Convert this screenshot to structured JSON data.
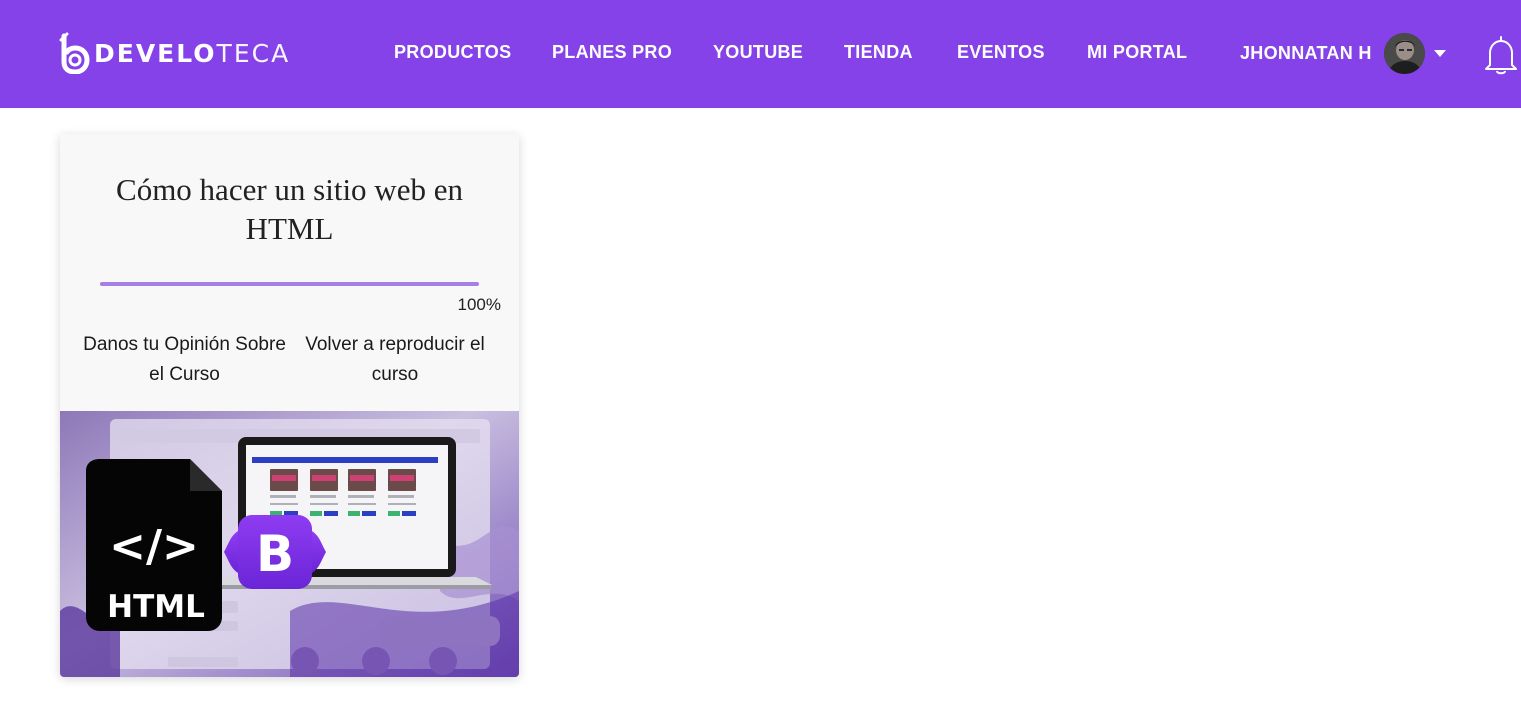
{
  "colors": {
    "header_bg": "#8442e8",
    "progress_fill": "#a67ee6",
    "bootstrap_purple": "#7a2fe6"
  },
  "brand": {
    "logo_icon": "develoteca-b-icon",
    "name_bold": "DEVELO",
    "name_light": "TECA"
  },
  "nav": {
    "items": [
      {
        "label": "PRODUCTOS"
      },
      {
        "label": "PLANES PRO"
      },
      {
        "label": "YOUTUBE"
      },
      {
        "label": "TIENDA"
      },
      {
        "label": "EVENTOS"
      },
      {
        "label": "MI PORTAL"
      }
    ]
  },
  "user": {
    "name": "JHONNATAN H",
    "avatar_icon": "user-avatar",
    "menu_icon": "caret-down-icon"
  },
  "notifications": {
    "icon": "bell-icon"
  },
  "course": {
    "title": "Cómo hacer un sitio web en HTML",
    "progress": 1.0,
    "progress_label": "100%",
    "actions": {
      "opinion": "Danos tu Opinión Sobre el Curso",
      "replay": "Volver a reproducir el curso"
    },
    "image": {
      "html_badge_text": "HTML",
      "html_tag_text": "</>",
      "bootstrap_letter": "B"
    }
  }
}
